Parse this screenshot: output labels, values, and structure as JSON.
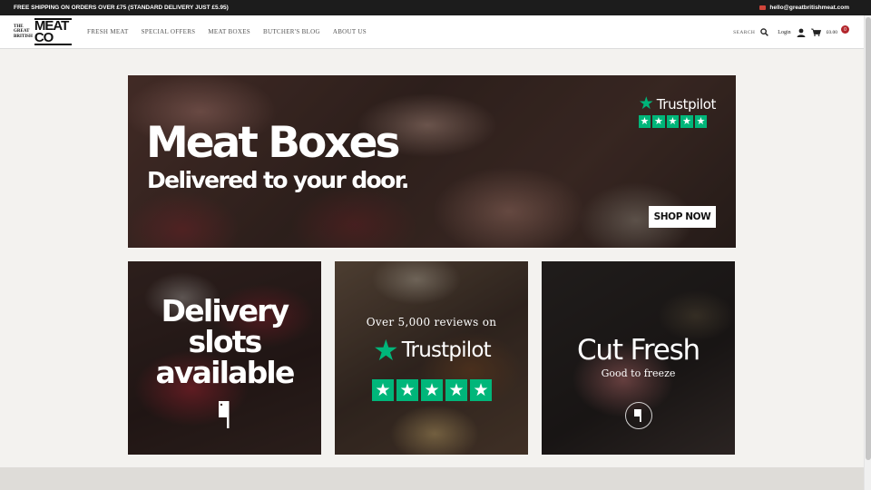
{
  "topbar": {
    "promo": "FREE SHIPPING ON ORDERS OVER £75 (STANDARD DELIVERY JUST £5.95)",
    "email": "hello@greatbritishmeat.com"
  },
  "logo": {
    "line1": "THE GREAT",
    "line2": "BRITISH",
    "big": "MEAT CO"
  },
  "nav": [
    "FRESH MEAT",
    "SPECIAL OFFERS",
    "MEAT BOXES",
    "BUTCHER'S BLOG",
    "ABOUT US"
  ],
  "header": {
    "search_label": "SEARCH",
    "login_label": "Login",
    "cart_total": "£0.00",
    "cart_count": "0"
  },
  "hero": {
    "title": "Meat Boxes",
    "subtitle": "Delivered to your door.",
    "trustpilot": "Trustpilot",
    "cta": "SHOP NOW"
  },
  "tiles": {
    "delivery": {
      "line1": "Delivery",
      "line2": "slots",
      "line3": "available"
    },
    "reviews": {
      "small": "Over 5,000 reviews on",
      "trustpilot": "Trustpilot"
    },
    "cut": {
      "title": "Cut Fresh",
      "subtitle": "Good to freeze"
    }
  },
  "colors": {
    "trustpilot_green": "#00b67a",
    "topbar_bg": "#1c1c1c",
    "cart_badge": "#b3262c"
  }
}
